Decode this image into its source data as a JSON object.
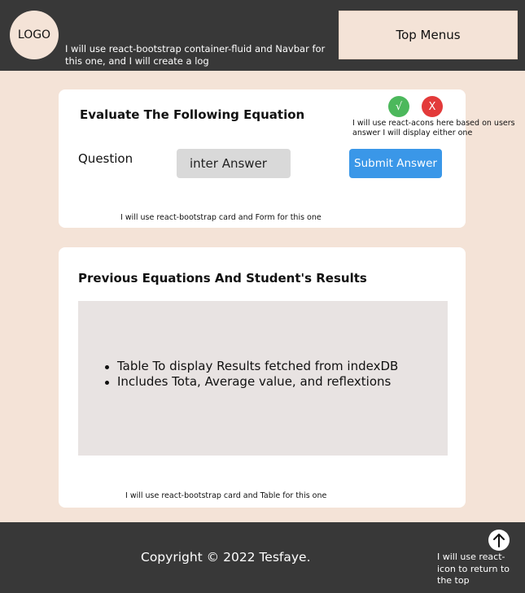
{
  "header": {
    "logo_text": "LOGO",
    "note": "I will use react-bootstrap container-fluid and Navbar for this one, and I will create a log",
    "top_menus_label": "Top Menus"
  },
  "equation_card": {
    "title": "Evaluate The Following Equation",
    "question_label": "Question",
    "answer_placeholder": "inter Answer",
    "submit_label": "Submit Answer",
    "check_icon_glyph": "√",
    "x_icon_glyph": "X",
    "icons_note": "I will use react-acons here based on users answer I will display either one",
    "card_note": "I will use react-bootstrap card and Form for this one"
  },
  "results_card": {
    "title": "Previous Equations And Student's Results",
    "bullets": [
      "Table To display Results fetched from indexDB",
      "Includes Tota, Average value, and reflextions"
    ],
    "card_note": "I will use react-bootstrap card and Table for this one"
  },
  "footer": {
    "copyright": "Copyright © 2022 Tesfaye.",
    "to_top_icon": "arrow-up-circle-icon",
    "note": "I will use react-icon to return to the top"
  },
  "colors": {
    "page_background": "#f4e3d7",
    "bar_background": "#383838",
    "card_background": "#ffffff",
    "submit_button": "#3a97e8",
    "check_icon": "#4cb85c",
    "x_icon": "#e33a3a",
    "input_background": "#d9d9d9",
    "table_placeholder": "#e8e3e2"
  }
}
